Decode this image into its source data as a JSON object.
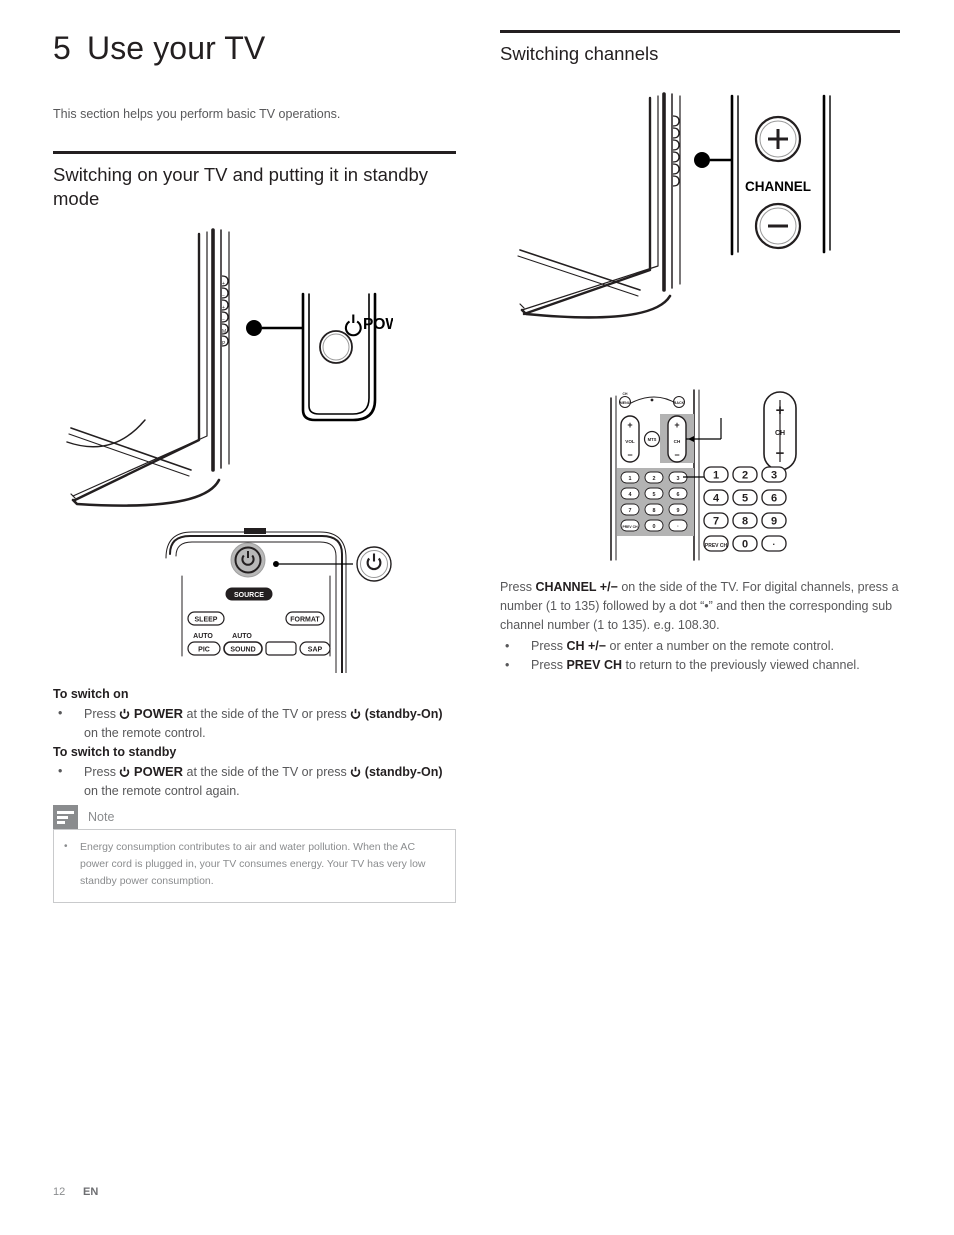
{
  "chapter": {
    "number": "5",
    "title": "Use your TV",
    "intro": "This section helps you perform basic TV operations."
  },
  "left": {
    "heading": "Switching on your TV and putting it in standby mode",
    "switch_on_label": "To switch on",
    "switch_on_bullet": {
      "press": "Press",
      "power": "POWER",
      "mid": "at the side of the TV or press",
      "standby": "(standby-On)",
      "tail": "on the remote control."
    },
    "switch_standby_label": "To switch to standby",
    "switch_standby_bullet": {
      "press": "Press",
      "power": "POWER",
      "mid": "at the side of the TV or press",
      "standby": "(standby-On)",
      "tail": "on the remote control again."
    },
    "figure_tv": {
      "callout_label": "POWER",
      "power_icon": "power-icon"
    },
    "figure_remote": {
      "buttons": [
        "SOURCE",
        "SLEEP",
        "FORMAT",
        "AUTO",
        "PIC",
        "AUTO",
        "SOUND",
        "SAP"
      ]
    }
  },
  "right": {
    "heading": "Switching channels",
    "figure_tv": {
      "channel_label": "CHANNEL",
      "plus": "+",
      "minus": "−"
    },
    "figure_remote": {
      "ch_label": "CH",
      "vol_label": "VOL",
      "mts_label": "MTS",
      "menu_label": "MENU",
      "back_label": "BACK",
      "plus": "+",
      "minus": "−",
      "keypad": [
        "1",
        "2",
        "3",
        "4",
        "5",
        "6",
        "7",
        "8",
        "9",
        "PREV CH",
        "0",
        "·"
      ],
      "callout_keypad": [
        "1",
        "2",
        "3",
        "4",
        "5",
        "6",
        "7",
        "8",
        "9",
        "PREV CH",
        "0",
        "·"
      ]
    },
    "paragraph": {
      "p1_a": "Press",
      "p1_b": "CHANNEL +/−",
      "p1_c": "on the side of the TV. For digital channels, press a number (1 to 135) followed by a dot “•” and then the corresponding sub channel number (1 to 135). e.g. 108.30."
    },
    "bullets": [
      {
        "a": "Press",
        "b": "CH +/−",
        "c": "or enter a number on the remote control."
      },
      {
        "a": "Press",
        "b": "PREV CH",
        "c": "to return to the previously viewed channel."
      }
    ]
  },
  "footer": {
    "page": "12",
    "language": "EN"
  },
  "colors": {
    "ink": "#231f20",
    "body_text": "#58585a",
    "note_gray": "#8a8c8e",
    "note_border": "#c9cacc",
    "highlight_gray": "#b3b3b3"
  }
}
